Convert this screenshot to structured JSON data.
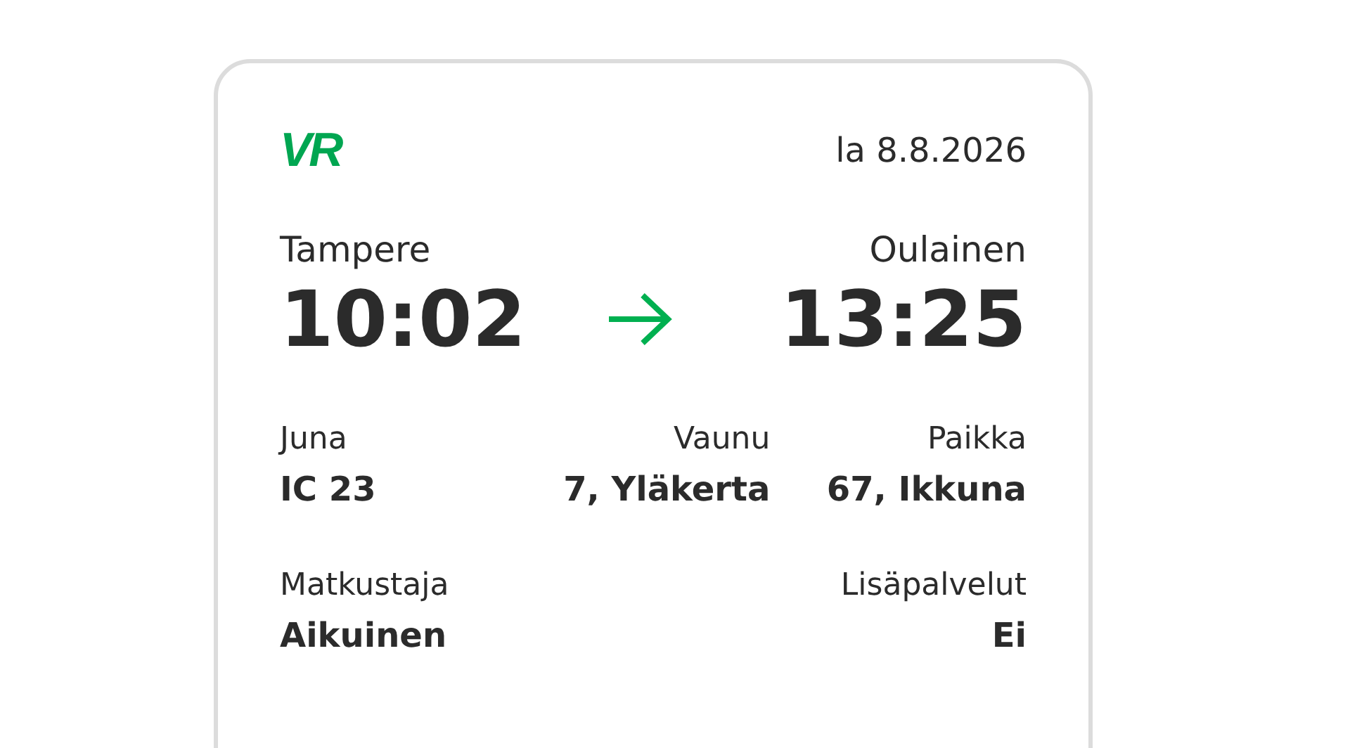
{
  "ticket": {
    "logo": "VR",
    "date": "la 8.8.2026",
    "departure": {
      "station": "Tampere",
      "time": "10:02"
    },
    "arrival": {
      "station": "Oulainen",
      "time": "13:25"
    },
    "details": [
      {
        "label": "Juna",
        "value": "IC 23"
      },
      {
        "label": "Vaunu",
        "value": "7, Yläkerta"
      },
      {
        "label": "Paikka",
        "value": "67, Ikkuna"
      }
    ],
    "extra": [
      {
        "label": "Matkustaja",
        "value": "Aikuinen"
      },
      {
        "label": "Lisäpalvelut",
        "value": "Ei"
      }
    ]
  }
}
